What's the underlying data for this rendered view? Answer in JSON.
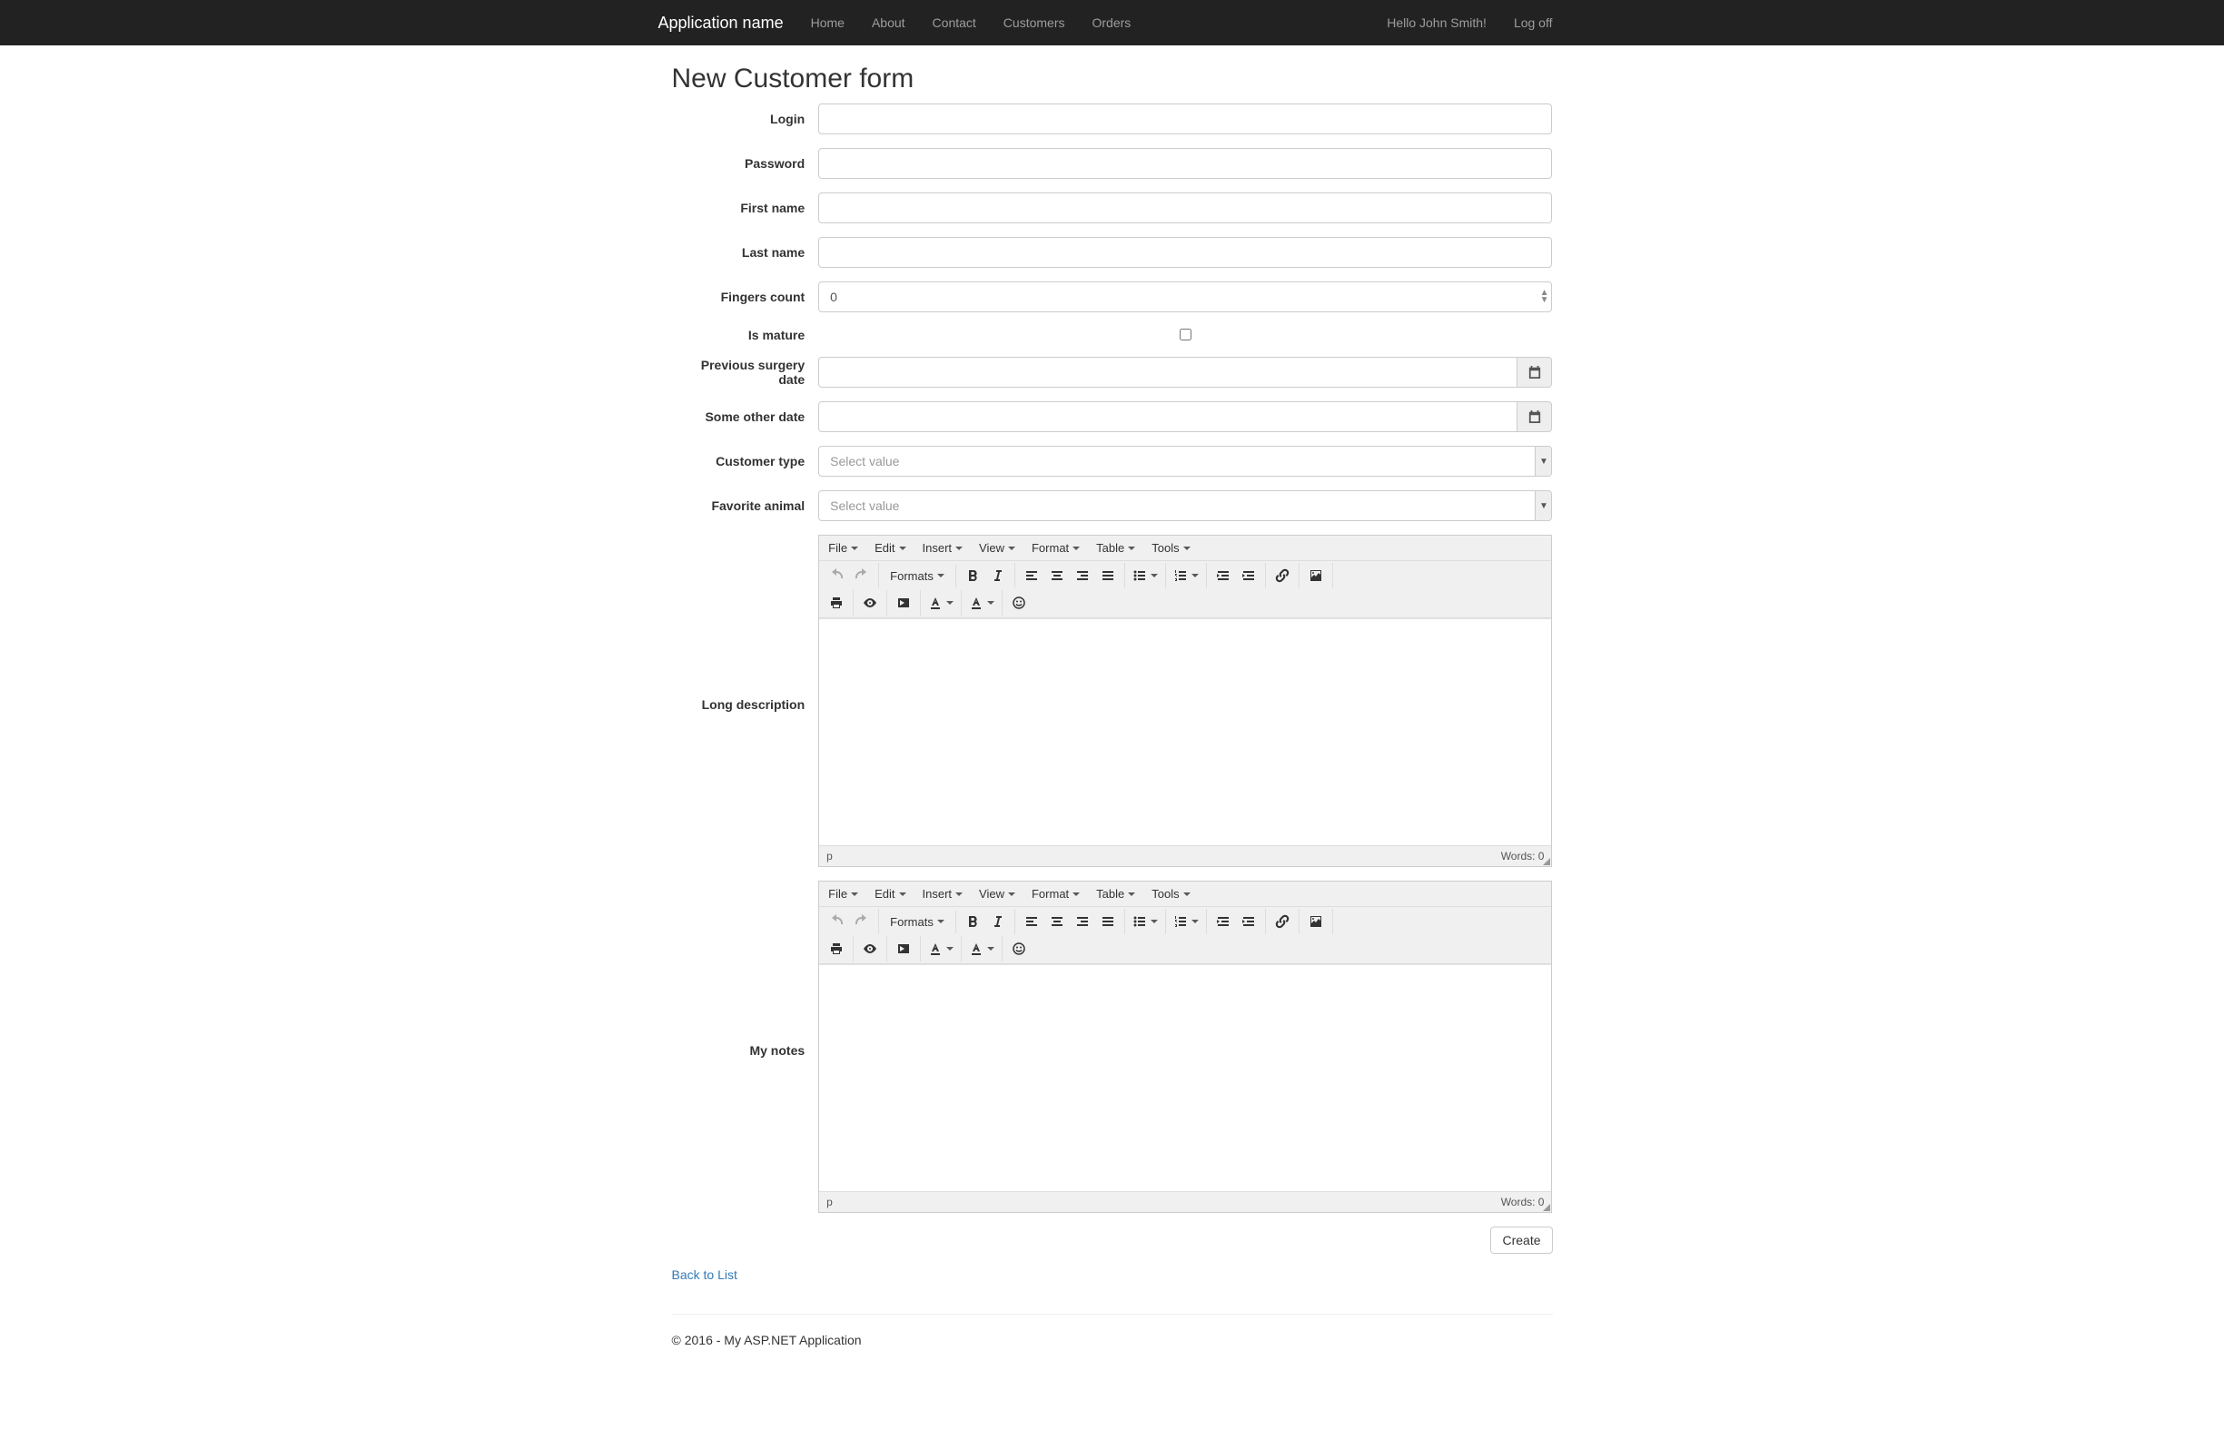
{
  "navbar": {
    "brand": "Application name",
    "links": [
      "Home",
      "About",
      "Contact",
      "Customers",
      "Orders"
    ],
    "greeting": "Hello John Smith!",
    "logoff": "Log off"
  },
  "page": {
    "title": "New Customer form",
    "back_link": "Back to List",
    "create_btn": "Create",
    "footer": "© 2016 - My ASP.NET Application"
  },
  "form": {
    "labels": {
      "login": "Login",
      "password": "Password",
      "first_name": "First name",
      "last_name": "Last name",
      "fingers_count": "Fingers count",
      "is_mature": "Is mature",
      "prev_surgery": "Previous surgery date",
      "other_date": "Some other date",
      "customer_type": "Customer type",
      "favorite_animal": "Favorite animal",
      "long_desc": "Long description",
      "my_notes": "My notes"
    },
    "values": {
      "fingers_count": "0",
      "select_placeholder": "Select value"
    }
  },
  "editor": {
    "menus": [
      "File",
      "Edit",
      "Insert",
      "View",
      "Format",
      "Table",
      "Tools"
    ],
    "formats_btn": "Formats",
    "status_path": "p",
    "word_count": "Words: 0"
  }
}
